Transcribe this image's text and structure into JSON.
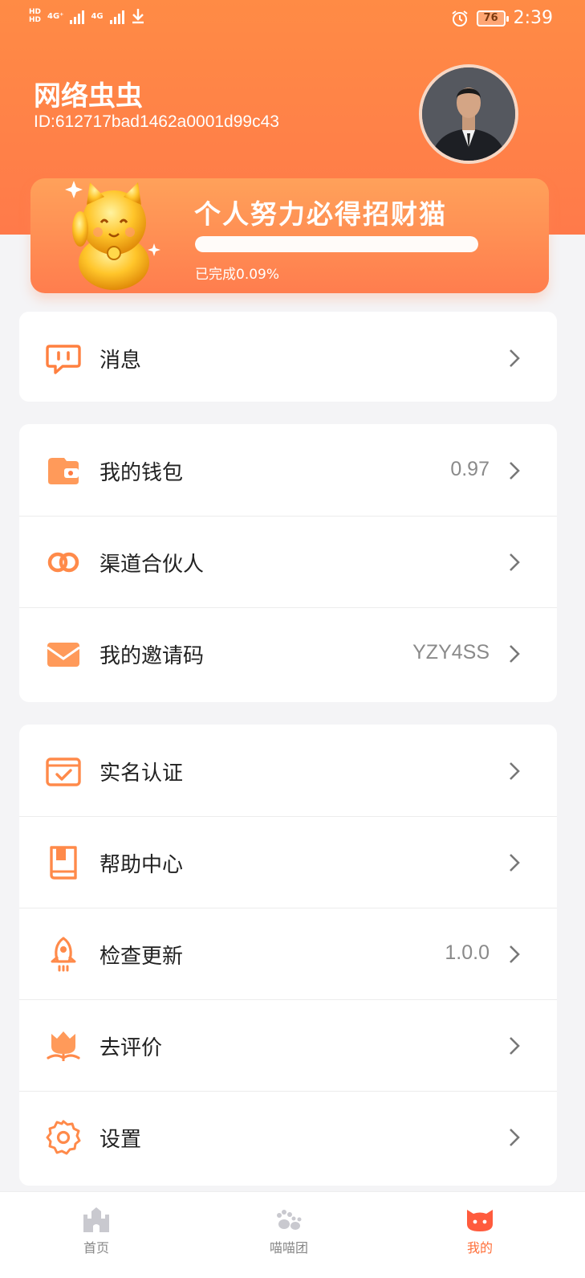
{
  "status_bar": {
    "left_hd_1": "HD",
    "left_hd_2": "HD",
    "net_1": "4G⁺",
    "net_2": "4G",
    "battery": "76",
    "time": "2:39"
  },
  "profile": {
    "username": "网络虫虫",
    "id": "ID:612717bad1462a0001d99c43"
  },
  "banner": {
    "title": "个人努力必得招财猫",
    "progress_percent": 0.09,
    "progress_text": "已完成0.09%"
  },
  "menu": {
    "messages": {
      "label": "消息",
      "icon": "message-icon"
    },
    "wallet": {
      "label": "我的钱包",
      "value": "0.97",
      "icon": "wallet-icon"
    },
    "partner": {
      "label": "渠道合伙人",
      "icon": "link-icon"
    },
    "invite": {
      "label": "我的邀请码",
      "value": "YZY4SS",
      "icon": "envelope-icon"
    },
    "verify": {
      "label": "实名认证",
      "icon": "id-card-icon"
    },
    "help": {
      "label": "帮助中心",
      "icon": "book-icon"
    },
    "update": {
      "label": "检查更新",
      "value": "1.0.0",
      "icon": "rocket-icon"
    },
    "rate": {
      "label": "去评价",
      "icon": "flower-icon"
    },
    "settings": {
      "label": "设置",
      "icon": "gear-icon"
    }
  },
  "bottom_nav": {
    "home": "首页",
    "team": "喵喵团",
    "mine": "我的"
  },
  "colors": {
    "accent": "#ff7a45",
    "header_gradient_top": "#ff8b45",
    "active_tab": "#ff6f3a"
  }
}
